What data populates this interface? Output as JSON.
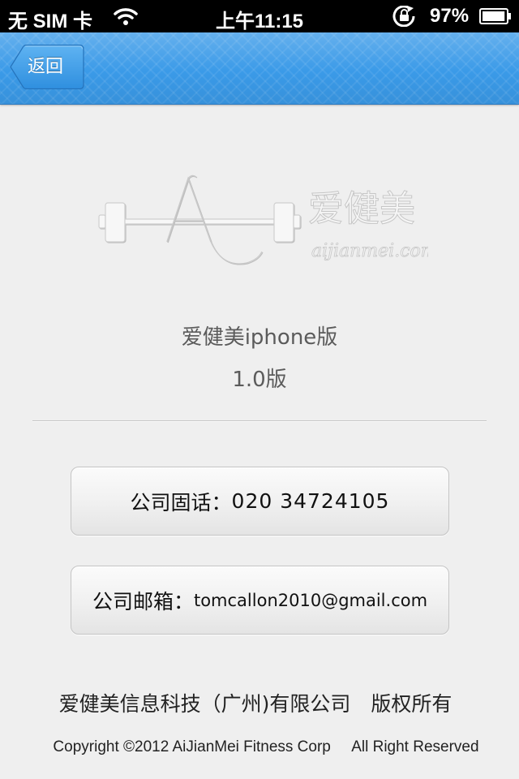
{
  "status_bar": {
    "carrier": "无 SIM 卡",
    "time": "上午11:15",
    "battery_percent": "97%",
    "battery_level": 0.97,
    "icons": [
      "wifi-icon",
      "rotation-lock-icon",
      "battery-icon"
    ]
  },
  "navbar": {
    "back_label": "返回",
    "accent_color": "#3a9ae8"
  },
  "logo": {
    "letter": "A",
    "chinese": "爱健美",
    "domain": "aijianmei.com"
  },
  "about": {
    "app_name": "爱健美iphone版",
    "version": "1.0版"
  },
  "contacts": {
    "phone_label": "公司固话：",
    "phone_value": "020 34724105",
    "email_label": "公司邮箱：",
    "email_value": "tomcallon2010@gmail.com"
  },
  "footer": {
    "company": "爱健美信息科技（广州)有限公司　版权所有",
    "copyright": "Copyright ©2012 AiJianMei Fitness Corp     All Right Reserved"
  }
}
